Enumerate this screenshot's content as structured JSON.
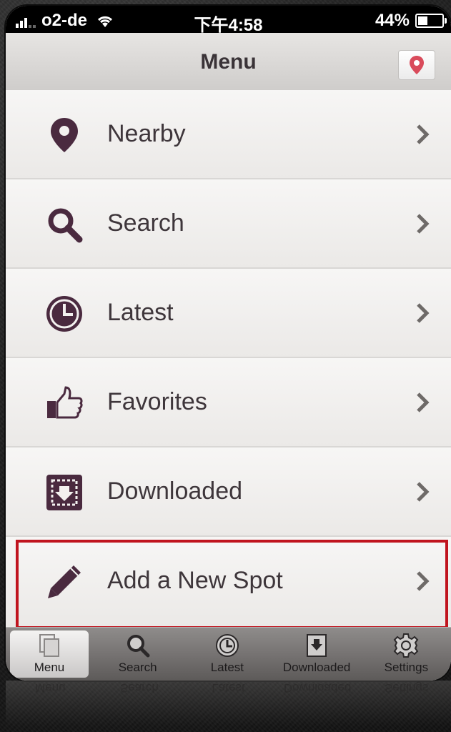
{
  "status_bar": {
    "carrier": "o2-de",
    "time": "下午4:58",
    "battery": "44%",
    "battery_level": 0.44
  },
  "nav": {
    "title": "Menu",
    "map_button_icon": "map-pin-icon"
  },
  "menu": {
    "items": [
      {
        "label": "Nearby",
        "icon": "location-pin-icon"
      },
      {
        "label": "Search",
        "icon": "magnifier-icon"
      },
      {
        "label": "Latest",
        "icon": "clock-icon"
      },
      {
        "label": "Favorites",
        "icon": "thumbs-up-icon"
      },
      {
        "label": "Downloaded",
        "icon": "download-box-icon"
      },
      {
        "label": "Add a New Spot",
        "icon": "pencil-icon",
        "highlighted": true
      }
    ]
  },
  "tab_bar": {
    "tabs": [
      {
        "label": "Menu",
        "icon": "pages-icon",
        "active": true
      },
      {
        "label": "Search",
        "icon": "magnifier-icon"
      },
      {
        "label": "Latest",
        "icon": "clock-icon"
      },
      {
        "label": "Downloaded",
        "icon": "download-icon"
      },
      {
        "label": "Settings",
        "icon": "gear-icon"
      }
    ]
  },
  "colors": {
    "accent": "#4a2a3f",
    "highlight_border": "#c0141e",
    "pin_red": "#d94b5b"
  }
}
